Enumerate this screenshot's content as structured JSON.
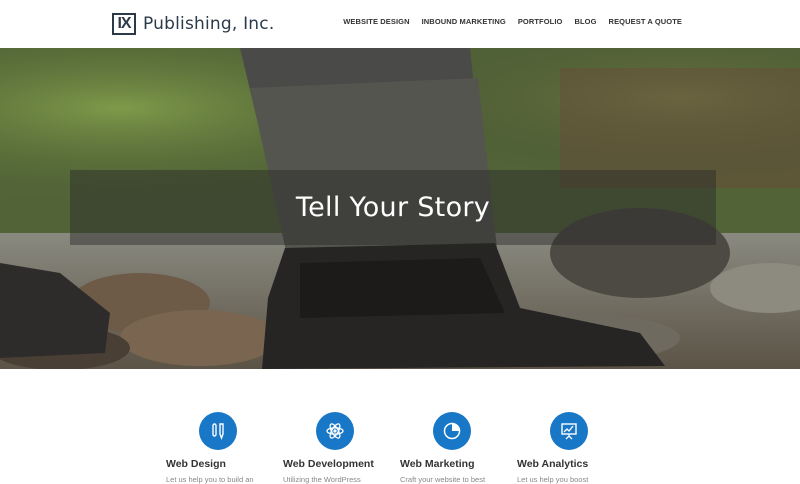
{
  "header": {
    "logo_mark": "IX",
    "logo_text": "Publishing, Inc.",
    "nav": [
      {
        "label": "WEBSITE DESIGN"
      },
      {
        "label": "INBOUND MARKETING"
      },
      {
        "label": "PORTFOLIO"
      },
      {
        "label": "BLOG"
      },
      {
        "label": "REQUEST A QUOTE"
      }
    ]
  },
  "hero": {
    "title": "Tell Your Story"
  },
  "services": [
    {
      "icon": "pen-tools-icon",
      "title": "Web Design",
      "desc": "Let us help you to build an"
    },
    {
      "icon": "atom-icon",
      "title": "Web Development",
      "desc": "Utilizing the WordPress"
    },
    {
      "icon": "pie-chart-icon",
      "title": "Web Marketing",
      "desc": "Craft your website to best"
    },
    {
      "icon": "presentation-chart-icon",
      "title": "Web Analytics",
      "desc": "Let us help you boost"
    }
  ],
  "colors": {
    "accent": "#1877c6",
    "logo": "#2b3a4a"
  }
}
